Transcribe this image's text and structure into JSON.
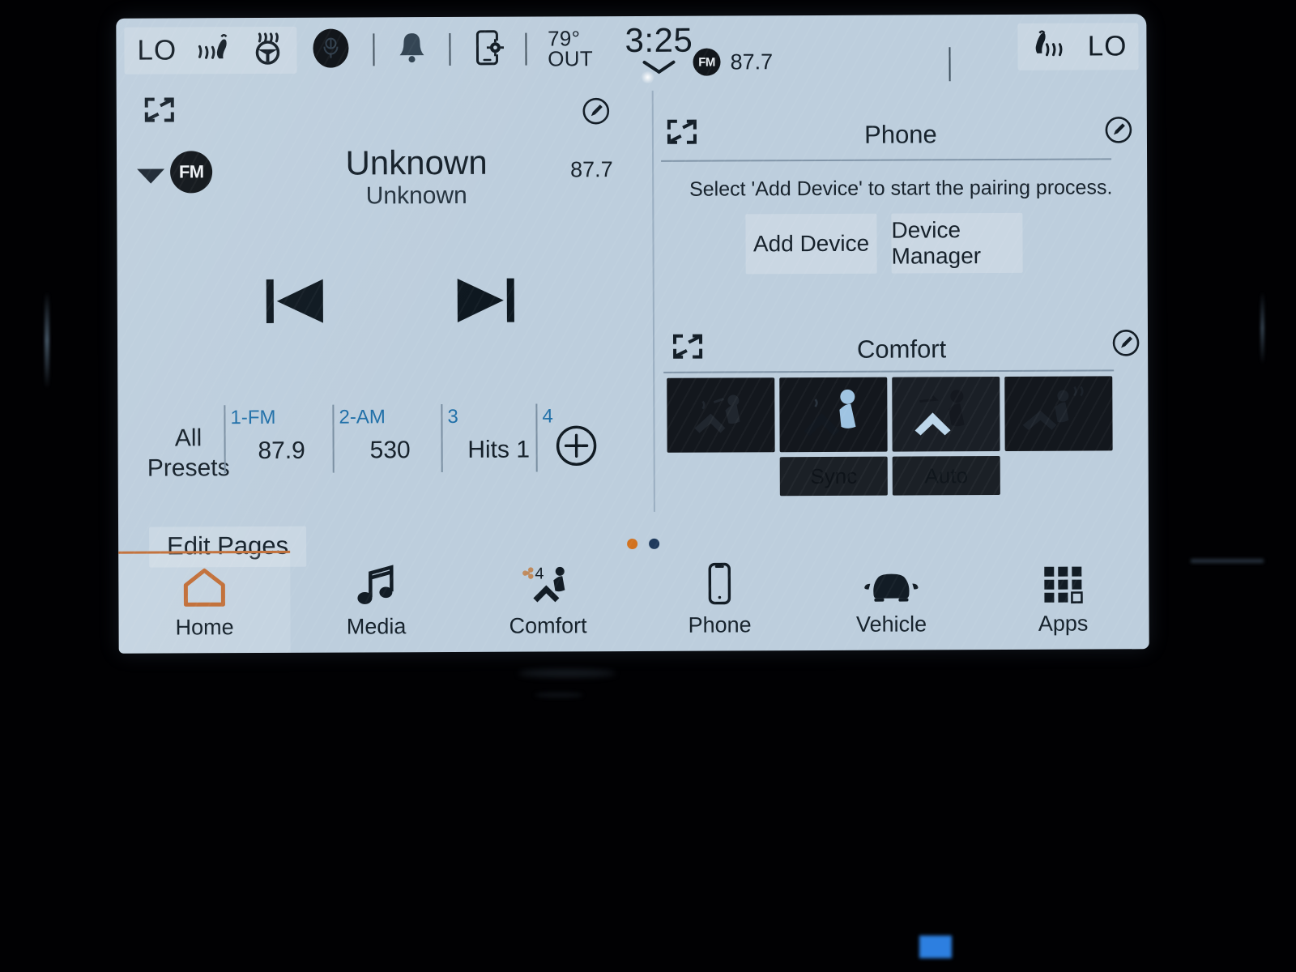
{
  "status_bar": {
    "left_temp": "LO",
    "right_temp": "LO",
    "heated_seat_icon": "heated-seat-icon",
    "heated_wheel_icon": "heated-steering-wheel-icon",
    "voice_icon": "voice-assistant-icon",
    "bell_icon": "notification-bell-icon",
    "phone_settings_icon": "phone-settings-icon",
    "outside_temp": "79°",
    "outside_label": "OUT",
    "clock": "3:25",
    "chevron_icon": "chevron-down-icon",
    "now_playing_band": "FM",
    "now_playing_freq": "87.7",
    "right_heated_seat_icon": "heated-seat-icon"
  },
  "media": {
    "expand_icon": "expand-icon",
    "edit_icon": "edit-pencil-icon",
    "source_caret_icon": "caret-down-icon",
    "source_badge": "FM",
    "title": "Unknown",
    "subtitle": "Unknown",
    "frequency": "87.7",
    "prev_icon": "previous-track-icon",
    "next_icon": "next-track-icon",
    "all_presets_label": "All\nPresets",
    "all_presets_line1": "All",
    "all_presets_line2": "Presets",
    "presets": [
      {
        "number": "1-FM",
        "value": "87.9"
      },
      {
        "number": "2-AM",
        "value": "530"
      },
      {
        "number": "3",
        "value": "Hits 1"
      },
      {
        "number": "4",
        "value": ""
      }
    ],
    "add_preset_icon": "add-preset-icon"
  },
  "phone": {
    "title": "Phone",
    "expand_icon": "expand-icon",
    "edit_icon": "edit-pencil-icon",
    "message": "Select 'Add Device' to start the pairing process.",
    "add_device_label": "Add Device",
    "device_manager_label": "Device Manager"
  },
  "comfort": {
    "title": "Comfort",
    "expand_icon": "expand-icon",
    "edit_icon": "edit-pencil-icon",
    "tiles": [
      {
        "name": "driver-seat-heat-tile",
        "state": "off"
      },
      {
        "name": "driver-seat-climate-tile",
        "state": "on"
      },
      {
        "name": "passenger-seat-climate-tile",
        "state": "on"
      },
      {
        "name": "passenger-seat-heat-tile",
        "state": "off"
      }
    ],
    "sync_label": "Sync",
    "auto_label": "Auto"
  },
  "home": {
    "edit_pages_label": "Edit Pages",
    "page_dots": [
      {
        "active": true,
        "color": "#d2721f"
      },
      {
        "active": false,
        "color": "#1f3a5c"
      }
    ]
  },
  "nav": {
    "items": [
      {
        "label": "Home",
        "icon": "home-icon",
        "active": true
      },
      {
        "label": "Media",
        "icon": "music-note-icon",
        "active": false
      },
      {
        "label": "Comfort",
        "icon": "seat-climate-icon",
        "active": false,
        "badge": "4"
      },
      {
        "label": "Phone",
        "icon": "phone-icon",
        "active": false
      },
      {
        "label": "Vehicle",
        "icon": "car-icon",
        "active": false
      },
      {
        "label": "Apps",
        "icon": "apps-grid-icon",
        "active": false
      }
    ]
  },
  "colors": {
    "screen_bg": "#bdcedd",
    "accent_orange": "#c2703a",
    "preset_blue": "#1f6fa8",
    "tile_dark": "#13171d",
    "highlight_blue": "#9fc4e2"
  }
}
